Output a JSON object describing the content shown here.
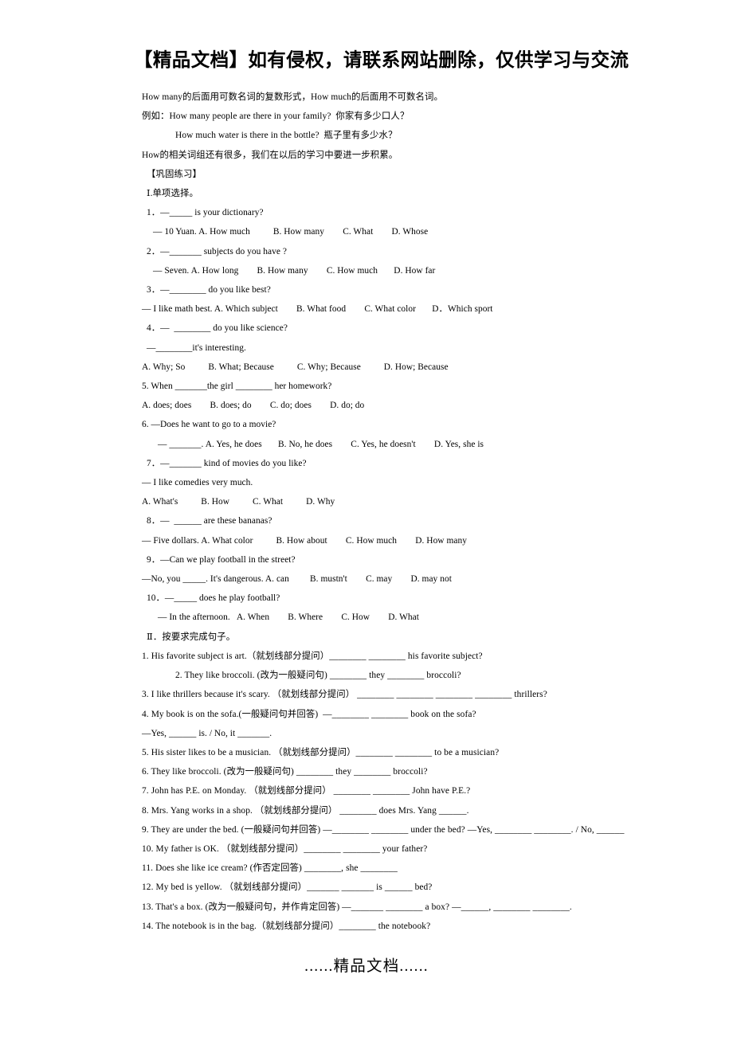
{
  "document": {
    "header_notice": "【精品文档】如有侵权，请联系网站删除，仅供学习与交流",
    "footer_notice": "......精品文档......",
    "intro": {
      "line1": "How many的后面用可数名词的复数形式，How much的后面用不可数名词。",
      "line2": "例如：How many people are there in your family?  你家有多少口人？",
      "line3": "How much water is there in the bottle?  瓶子里有多少水？",
      "line4": "How的相关词组还有很多，我们在以后的学习中要进一步积累。"
    },
    "practice_heading": "【巩固练习】",
    "section1": {
      "heading": "Ⅰ.单项选择。",
      "items": [
        {
          "stem": "1．—_____ is your dictionary?",
          "answer_line": "— 10 Yuan. A. How much",
          "options": [
            "B. How many",
            "C. What",
            "D. Whose"
          ]
        },
        {
          "stem": "2．—_______ subjects do you have ?",
          "answer_line": "— Seven. A. How long",
          "options": [
            "B. How many",
            "C. How much",
            "D. How far"
          ]
        },
        {
          "stem": "3．—________ do you like best?",
          "answer_line": "— I like math best. A. Which subject",
          "options": [
            "B. What food",
            "C. What color",
            "D．Which sport"
          ]
        },
        {
          "stem": "4．—  ________ do you like science?",
          "answer_line": "—________it's interesting.",
          "options_line": "A. Why; So          B. What; Because          C. Why; Because          D. How; Because"
        },
        {
          "stem": "5. When _______the girl ________ her homework?",
          "options_line": "A. does; does        B. does; do        C. do; does        D. do; do"
        },
        {
          "stem": "6. —Does he want to go to a movie?",
          "answer_line": "— _______. A. Yes, he does",
          "options": [
            "B. No, he does",
            "C. Yes, he doesn't",
            "D. Yes, she is"
          ]
        },
        {
          "stem": "7．—_______ kind of movies do you like?",
          "answer_line": "— I like comedies very much.",
          "options_line": "A. What's          B. How          C. What          D. Why"
        },
        {
          "stem": "8．—  ______ are these bananas?",
          "answer_line": "— Five dollars. A. What color",
          "options": [
            "B. How about",
            "C. How much",
            "D. How many"
          ]
        },
        {
          "stem": "9．—Can we play football in the street?",
          "answer_line": "—No, you _____. It's dangerous. A. can",
          "options": [
            "B. mustn't",
            "C. may",
            "D. may not"
          ]
        },
        {
          "stem": "10．—_____ does he play football?",
          "answer_line": "— In the afternoon.   A. When",
          "options": [
            "B. Where",
            "C. How",
            "D. What"
          ]
        }
      ]
    },
    "section2": {
      "heading": "Ⅱ．按要求完成句子。",
      "items": [
        "1. His favorite subject is art.（就划线部分提问）________ ________ his favorite subject?",
        "2. They like broccoli. (改为一般疑问句) ________ they ________ broccoli?",
        "3. I like thrillers because it's scary. （就划线部分提问） ________ ________ ________ ________ thrillers?",
        "4. My book is on the sofa.(一般疑问句并回答)  —________ ________ book on the sofa?",
        "—Yes, ______ is. / No, it _______.",
        "5. His sister likes to be a musician. （就划线部分提问）________ ________ to be a musician?",
        "6. They like broccoli. (改为一般疑问句) ________ they ________ broccoli?",
        "7. John has P.E. on Monday. （就划线部分提问） ________ ________ John have P.E.?",
        "8. Mrs. Yang works in a shop. （就划线部分提问） ________ does Mrs. Yang ______.",
        "9. They are under the bed. (一般疑问句并回答) —________ ________ under the bed? —Yes, ________ ________. / No, ______",
        "10. My father is OK. （就划线部分提问）________ ________ your father?",
        "11. Does she like ice cream? (作否定回答) ________, she ________",
        "12. My bed is yellow. （就划线部分提问）_______ _______ is ______ bed?",
        "13. That's a box. (改为一般疑问句，并作肯定回答) —_______ ________ a box? —______, ________ ________.",
        "14. The notebook is in the bag.（就划线部分提问）________ the notebook?"
      ]
    }
  }
}
